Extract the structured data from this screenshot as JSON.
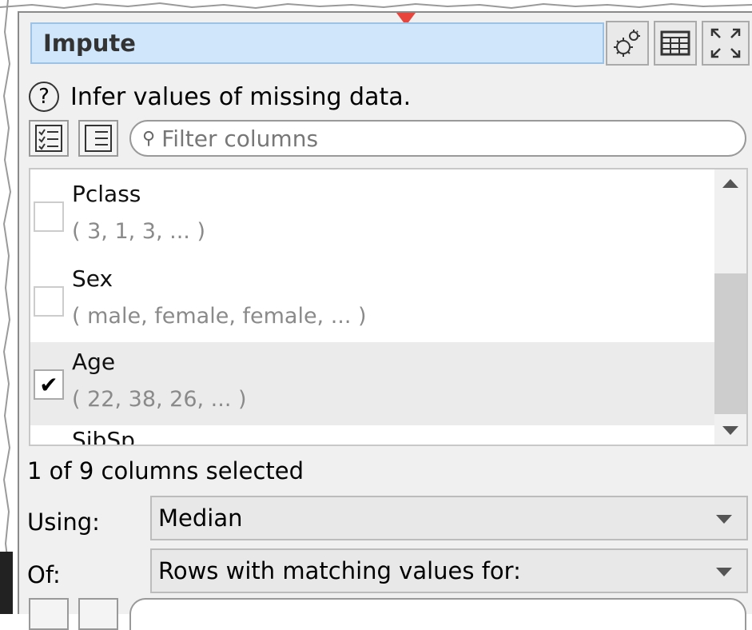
{
  "header": {
    "title": "Impute"
  },
  "help": {
    "text": "Infer values of missing data.",
    "icon_char": "?"
  },
  "filter": {
    "placeholder": "Filter columns"
  },
  "columns_list": {
    "items": [
      {
        "name": "Pclass",
        "values": "( 3, 1, 3, ... )",
        "checked": false
      },
      {
        "name": "Sex",
        "values": "( male, female, female, ... )",
        "checked": false
      },
      {
        "name": "Age",
        "values": "( 22, 38, 26, ... )",
        "checked": true
      }
    ],
    "partial_next": "SibSp"
  },
  "status": {
    "text": "1 of 9 columns selected"
  },
  "using": {
    "label": "Using:",
    "value": "Median"
  },
  "of": {
    "label": "Of:",
    "value": "Rows with matching values for:"
  },
  "icons": {
    "settings": "gear-icon",
    "table": "table-icon",
    "expand": "expand-icon",
    "checklist": "checklist-icon",
    "list": "list-icon",
    "search": "search-icon"
  },
  "colors": {
    "title_bg": "#cfe6fb",
    "pointer": "#e8453c"
  }
}
